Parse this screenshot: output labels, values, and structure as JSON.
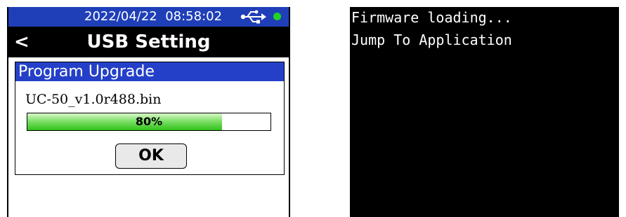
{
  "left_screen": {
    "status_bar": {
      "date": "2022/04/22",
      "time": "08:58:02",
      "usb_icon": "usb-icon",
      "connection_indicator_color": "#21d321",
      "background_color": "#1f3fb8"
    },
    "title_bar": {
      "back_label": "<",
      "title": "USB Setting"
    },
    "dialog": {
      "header": "Program Upgrade",
      "header_color": "#2440c8",
      "file_name": "UC-50_v1.0r488.bin",
      "progress": {
        "percent": 80,
        "label": "80%",
        "fill_color": "#30c21a"
      },
      "ok_label": "OK"
    }
  },
  "right_screen": {
    "lines": [
      "Firmware loading...",
      "Jump To Application"
    ]
  }
}
